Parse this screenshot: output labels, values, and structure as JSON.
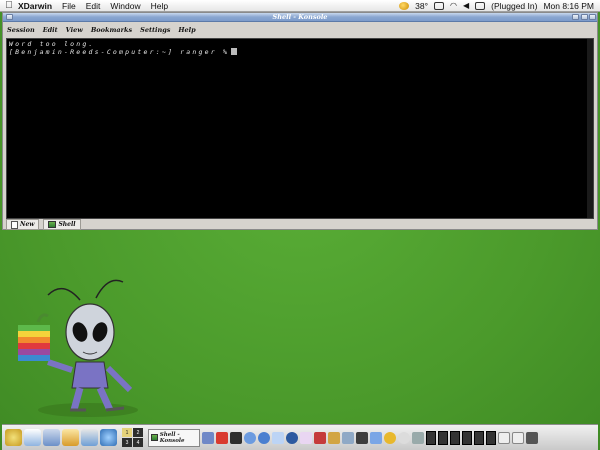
{
  "menubar": {
    "app_name": "XDarwin",
    "menus": [
      "File",
      "Edit",
      "Window",
      "Help"
    ],
    "temperature": "38°",
    "battery": "(Plugged In)",
    "clock": "Mon 8:16 PM"
  },
  "konsole": {
    "title": "Shell - Konsole",
    "menus": [
      "Session",
      "Edit",
      "View",
      "Bookmarks",
      "Settings",
      "Help"
    ],
    "terminal": {
      "line1": "Word too long.",
      "line2": "[Benjamin-Reeds-Computer:~] ranger %"
    },
    "tabs": {
      "new_label": "New",
      "shell_label": "Shell"
    }
  },
  "dock": {
    "pager": [
      "1",
      "2",
      "3",
      "4"
    ],
    "task_label": "Shell - Konsole"
  },
  "colors": {
    "desktop": "#4b9a2b",
    "terminal_bg": "#000000",
    "titlebar": "#8aa6d0"
  }
}
